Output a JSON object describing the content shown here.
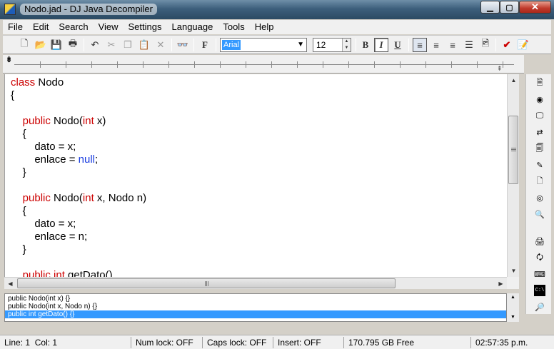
{
  "window": {
    "title": "Nodo.jad - DJ Java Decompiler",
    "minimize_glyph": "▁",
    "maximize_glyph": "▢",
    "close_glyph": "✕"
  },
  "menu": {
    "items": [
      "File",
      "Edit",
      "Search",
      "View",
      "Settings",
      "Language",
      "Tools",
      "Help"
    ]
  },
  "toolbar": {
    "font_value": "Arial",
    "size_value": "12",
    "icons": {
      "new": "🗋",
      "open": "📂",
      "save": "💾",
      "print": "🖶",
      "undo": "↶",
      "cut": "✂",
      "copy": "❐",
      "paste": "📋",
      "delete": "✕",
      "find": "👓",
      "font": "F",
      "bold": "B",
      "italic": "I",
      "underline": "U",
      "align_left": "≡",
      "align_center": "≡",
      "align_right": "≡",
      "bullets": "☰",
      "image": "🖻",
      "check": "✔",
      "edit_doc": "📝"
    }
  },
  "code": {
    "lines": [
      [
        {
          "t": "class",
          "c": "kw"
        },
        {
          "t": " Nodo"
        }
      ],
      [
        {
          "t": "{"
        }
      ],
      [],
      [
        {
          "t": "    "
        },
        {
          "t": "public",
          "c": "kw"
        },
        {
          "t": " Nodo("
        },
        {
          "t": "int",
          "c": "kw"
        },
        {
          "t": " x)"
        }
      ],
      [
        {
          "t": "    {"
        }
      ],
      [
        {
          "t": "        dato = x;"
        }
      ],
      [
        {
          "t": "        enlace = "
        },
        {
          "t": "null",
          "c": "lit"
        },
        {
          "t": ";"
        }
      ],
      [
        {
          "t": "    }"
        }
      ],
      [],
      [
        {
          "t": "    "
        },
        {
          "t": "public",
          "c": "kw"
        },
        {
          "t": " Nodo("
        },
        {
          "t": "int",
          "c": "kw"
        },
        {
          "t": " x, Nodo n)"
        }
      ],
      [
        {
          "t": "    {"
        }
      ],
      [
        {
          "t": "        dato = x;"
        }
      ],
      [
        {
          "t": "        enlace = n;"
        }
      ],
      [
        {
          "t": "    }"
        }
      ],
      [],
      [
        {
          "t": "    "
        },
        {
          "t": "public",
          "c": "kw"
        },
        {
          "t": " "
        },
        {
          "t": "int",
          "c": "kw"
        },
        {
          "t": " getDato()"
        }
      ]
    ]
  },
  "members": {
    "items": [
      "public Nodo(int x) {}",
      "public Nodo(int x, Nodo n) {}",
      "public int getDato() {}"
    ],
    "selected": "public int getDato() {}"
  },
  "scroll": {
    "up": "▲",
    "down": "▼",
    "left": "◀",
    "right": "▶"
  },
  "sidebar": {
    "icons": [
      "🗎",
      "◉",
      "🖵",
      "⇄",
      "🗐",
      "✎",
      "🗋",
      "◎",
      "🔍",
      "🖨",
      "🗘",
      "⌨",
      "C:\\",
      "🔎"
    ]
  },
  "ruler": {
    "left_marker": "⇟",
    "right_marker": "⇞"
  },
  "status": {
    "line_label": "Line:",
    "line_value": "1",
    "col_label": "Col:",
    "col_value": "1",
    "num_lock": "Num lock: OFF",
    "caps_lock": "Caps lock: OFF",
    "insert": "Insert: OFF",
    "free_space": "170.795 GB Free",
    "clock": "02:57:35 p.m."
  }
}
